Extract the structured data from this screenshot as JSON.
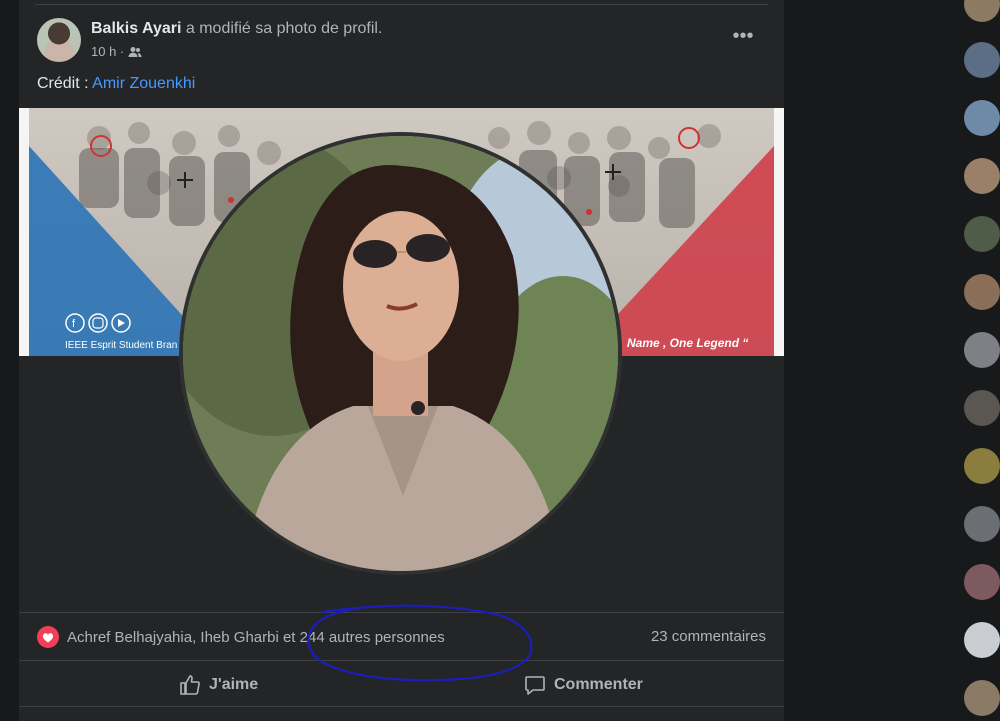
{
  "post": {
    "author": "Balkis Ayari",
    "action": " a modifié sa photo de profil.",
    "time": "10 h ·",
    "audience_icon": "friends-icon",
    "more_icon": "more-horizontal-icon",
    "credit_label": "Crédit : ",
    "credit_link": "Amir Zouenkhi",
    "cover_footer_left": "IEEE Esprit Student Bran",
    "cover_footer_right": "Name , One Legend “"
  },
  "stats": {
    "reaction_icon": "love-heart-icon",
    "reactions_text": "Achref Belhajyahia, Iheb Gharbi et 244 autres personnes",
    "comments_text": "23 commentaires"
  },
  "actions": {
    "like_label": "J'aime",
    "comment_label": "Commenter"
  },
  "colors": {
    "background": "#18191a",
    "card": "#242526",
    "link": "#4599ff",
    "cover_blue": "#2b73b6",
    "cover_red": "#cf3f4a",
    "annotation": "#1b1eb8"
  }
}
